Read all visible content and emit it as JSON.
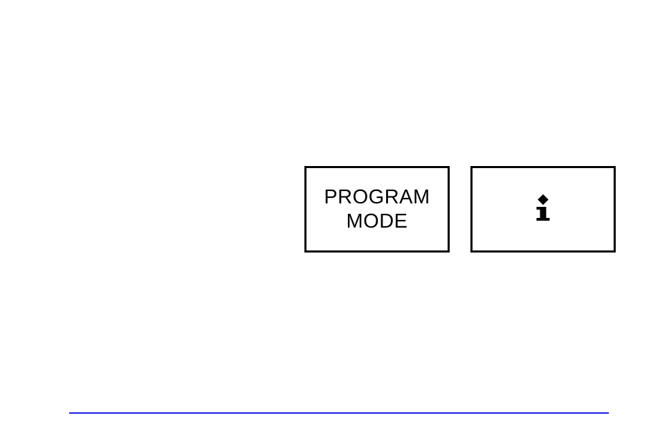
{
  "buttons": {
    "program_mode": {
      "line1": "PROGRAM",
      "line2": "MODE"
    },
    "info": {
      "symbol": "i"
    }
  }
}
